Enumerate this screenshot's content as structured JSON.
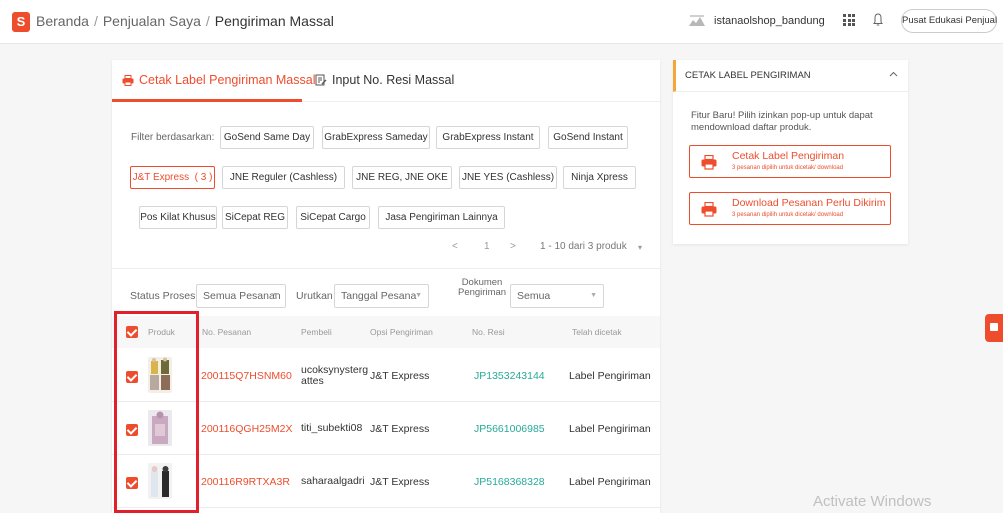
{
  "header": {
    "logo": "S",
    "breadcrumb": [
      "Beranda",
      "Penjualan Saya",
      "Pengiriman Massal"
    ],
    "separator": "/",
    "shop_name": "istanaolshop_bandung",
    "edu_button": "Pusat Edukasi Penjual"
  },
  "tabs": [
    {
      "label": "Cetak Label Pengiriman Massal",
      "active": true
    },
    {
      "label": "Input No. Resi Massal",
      "active": false
    }
  ],
  "filter": {
    "label": "Filter berdasarkan:",
    "couriers": [
      "GoSend Same Day",
      "GrabExpress Sameday",
      "GrabExpress Instant",
      "GoSend Instant",
      "J&T Express  ( 3 )",
      "JNE Reguler (Cashless)",
      "JNE REG, JNE OKE",
      "JNE YES (Cashless)",
      "Ninja Xpress",
      "Pos Kilat Khusus",
      "SiCepat REG",
      "SiCepat Cargo",
      "Jasa Pengiriman Lainnya"
    ],
    "selected": "J&T Express  ( 3 )"
  },
  "pagination": {
    "prev": "<",
    "page": "1",
    "next": ">",
    "range": "1 - 10 dari 3 produk",
    "caret": "▾"
  },
  "controls": {
    "status_label": "Status Proses",
    "status_value": "Semua Pesanan",
    "sort_label": "Urutkan",
    "sort_value": "Tanggal Pesana",
    "doc_label_1": "Dokumen",
    "doc_label_2": "Pengiriman",
    "doc_value": "Semua"
  },
  "table": {
    "headers": [
      "Produk",
      "No. Pesanan",
      "Pembeli",
      "Opsi Pengiriman",
      "No. Resi",
      "Telah dicetak"
    ],
    "rows": [
      {
        "order_no": "200115Q7HSNM60",
        "buyer_1": "ucoksynysterg",
        "buyer_2": "attes",
        "shipping": "J&T Express",
        "resi": "JP1353243144",
        "printed": "Label Pengiriman",
        "checked": true
      },
      {
        "order_no": "200116QGH25M2X",
        "buyer_1": "titi_subekti08",
        "buyer_2": "",
        "shipping": "J&T Express",
        "resi": "JP5661006985",
        "printed": "Label Pengiriman",
        "checked": true
      },
      {
        "order_no": "200116R9RTXA3R",
        "buyer_1": "saharaalgadri",
        "buyer_2": "",
        "shipping": "J&T Express",
        "resi": "JP5168368328",
        "printed": "Label Pengiriman",
        "checked": true
      }
    ]
  },
  "side_panel": {
    "title": "CETAK LABEL PENGIRIMAN",
    "info": "Fitur Baru! Pilih izinkan pop-up untuk dapat mendownload daftar produk.",
    "buttons": [
      {
        "label": "Cetak Label Pengiriman",
        "sub": "3 pesanan dipilih untuk dicetak/ download"
      },
      {
        "label": "Download Pesanan Perlu Dikirim",
        "sub": "3 pesanan dipilih untuk dicetak/ download"
      }
    ]
  },
  "watermark": "Activate Windows",
  "colors": {
    "accent": "#ee4d2d",
    "resi": "#26aa99",
    "highlight_box": "#e0202a"
  }
}
